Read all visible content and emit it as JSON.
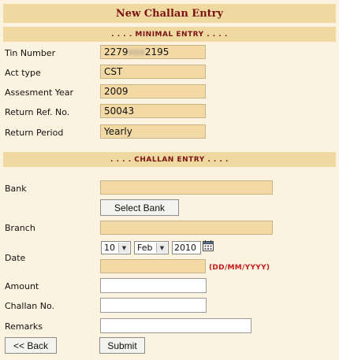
{
  "header": {
    "title": "New Challan Entry"
  },
  "minimal": {
    "section_title": ". . . . MINIMAL ENTRY . . . .",
    "fields": [
      {
        "label": "Tin Number",
        "value_start": "2279",
        "value_hidden": "xxx",
        "value_end": "2195"
      },
      {
        "label": "Act type",
        "value": "CST"
      },
      {
        "label": "Assesment Year",
        "value": "2009"
      },
      {
        "label": "Return Ref. No.",
        "value": "50043"
      },
      {
        "label": "Return Period",
        "value": "Yearly"
      }
    ]
  },
  "challan": {
    "section_title": ". . . . CHALLAN ENTRY . . . .",
    "bank_label": "Bank",
    "select_bank_label": "Select Bank",
    "branch_label": "Branch",
    "date_label": "Date",
    "date_day": "10",
    "date_month": "Feb",
    "date_year": "2010",
    "date_format_hint": "(DD/MM/YYYY)",
    "amount_label": "Amount",
    "challan_no_label": "Challan No.",
    "remarks_label": "Remarks"
  },
  "actions": {
    "back_label": "<< Back",
    "submit_label": "Submit"
  },
  "icons": {
    "calendar": "calendar-icon"
  },
  "colors": {
    "background": "#fbf3df",
    "bar": "#f0d9a0",
    "heading": "#7a1414",
    "hint": "#c31a1a",
    "field": "#f3d9a4"
  }
}
